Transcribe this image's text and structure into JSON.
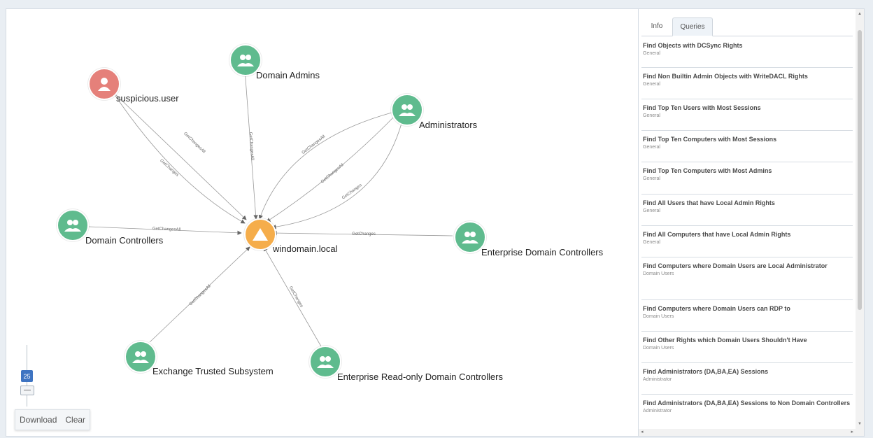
{
  "graph": {
    "nodes": {
      "suspicious_user": "suspicious.user",
      "domain_admins": "Domain Admins",
      "administrators": "Administrators",
      "domain_controllers": "Domain Controllers",
      "windomain": "windomain.local",
      "enterprise_dcs": "Enterprise Domain Controllers",
      "exchange": "Exchange Trusted Subsystem",
      "enterprise_ro_dcs": "Enterprise Read-only Domain Controllers"
    },
    "edge_labels": [
      "GetChangesAll",
      "GetChanges",
      "GetChangesAll",
      "GetChangesAll",
      "GetChangesAll",
      "GetChanges",
      "GetChangesAll",
      "GetChanges",
      "GetChangesAll",
      "GetChanges"
    ]
  },
  "zoom": {
    "level": "25"
  },
  "toolbar": {
    "download": "Download",
    "clear": "Clear"
  },
  "panel": {
    "tabs": [
      "Info",
      "Queries"
    ],
    "queries": [
      {
        "title": "Find Objects with DCSync Rights",
        "category": "General"
      },
      {
        "title": "Find Non Builtin Admin Objects with WriteDACL Rights",
        "category": "General"
      },
      {
        "title": "Find Top Ten Users with Most Sessions",
        "category": "General"
      },
      {
        "title": "Find Top Ten Computers with Most Sessions",
        "category": "General"
      },
      {
        "title": "Find Top Ten Computers with Most Admins",
        "category": "General"
      },
      {
        "title": "Find All Users that have Local Admin Rights",
        "category": "General"
      },
      {
        "title": "Find All Computers that have Local Admin Rights",
        "category": "General"
      },
      {
        "title": "Find Computers where Domain Users are Local Administrator",
        "category": "Domain Users"
      },
      {
        "title": "Find Computers where Domain Users can RDP to",
        "category": "Domain Users"
      },
      {
        "title": "Find Other Rights which Domain Users Shouldn't Have",
        "category": "Domain Users"
      },
      {
        "title": "Find Administrators (DA,BA,EA) Sessions",
        "category": "Administrator"
      },
      {
        "title": "Find Administrators (DA,BA,EA) Sessions to Non Domain Controllers",
        "category": "Administrator"
      }
    ]
  },
  "colors": {
    "group_node": "#5fbb8e",
    "user_node": "#e5807a",
    "domain_node": "#f5ad4b",
    "accent": "#3e74c2"
  }
}
